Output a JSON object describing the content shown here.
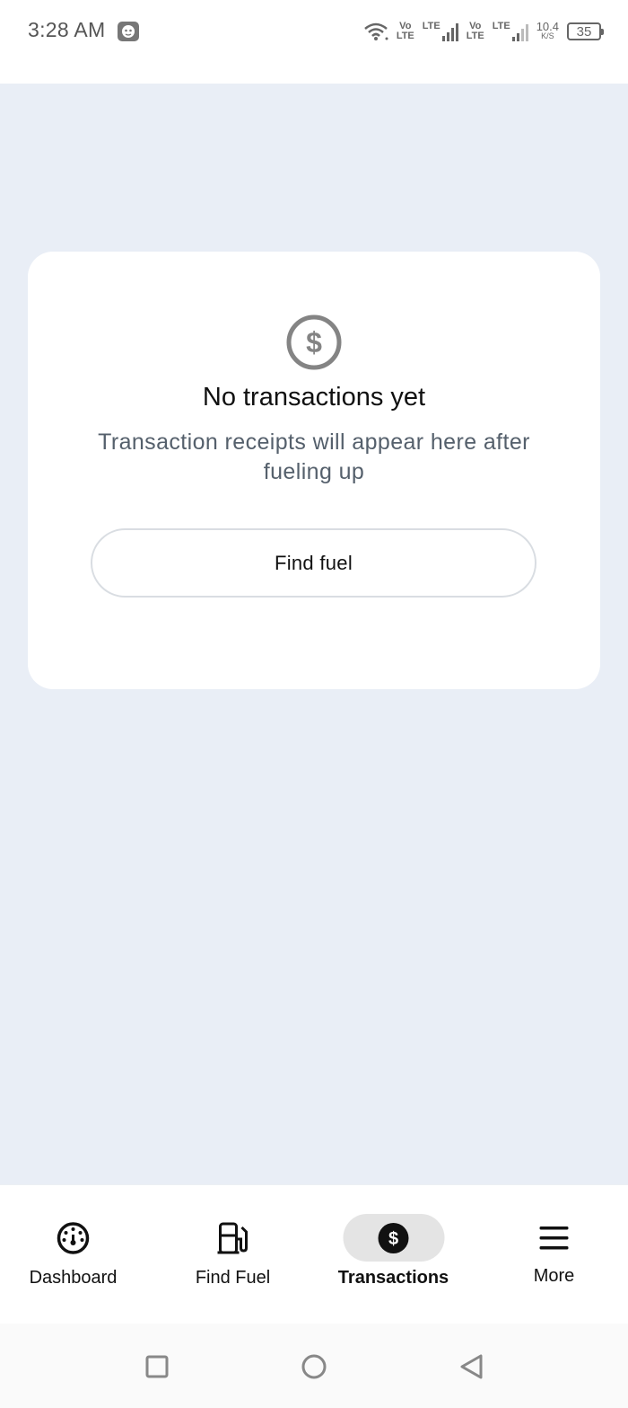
{
  "status_bar": {
    "time": "3:28 AM",
    "sim1_top": "Vo",
    "sim1_bottom": "LTE",
    "sim1_net": "LTE",
    "sim2_top": "Vo",
    "sim2_bottom": "LTE",
    "sim2_net": "LTE",
    "speed_value": "10.4",
    "speed_unit": "K/S",
    "battery": "35"
  },
  "empty_state": {
    "icon": "dollar-circle-icon",
    "title": "No transactions yet",
    "subtitle": "Transaction receipts will appear here after fueling up",
    "button_label": "Find fuel"
  },
  "bottom_nav": {
    "active": "Transactions",
    "items": [
      {
        "label": "Dashboard",
        "icon": "dashboard-gauge-icon"
      },
      {
        "label": "Find Fuel",
        "icon": "fuel-pump-icon"
      },
      {
        "label": "Transactions",
        "icon": "dollar-circle-icon"
      },
      {
        "label": "More",
        "icon": "menu-icon"
      }
    ]
  },
  "system_nav": {
    "recents": "square-icon",
    "home": "circle-icon",
    "back": "triangle-back-icon"
  },
  "colors": {
    "background": "#e9eef6",
    "card": "#ffffff",
    "subtitle": "#55606c",
    "active_pill": "#e4e4e4"
  }
}
